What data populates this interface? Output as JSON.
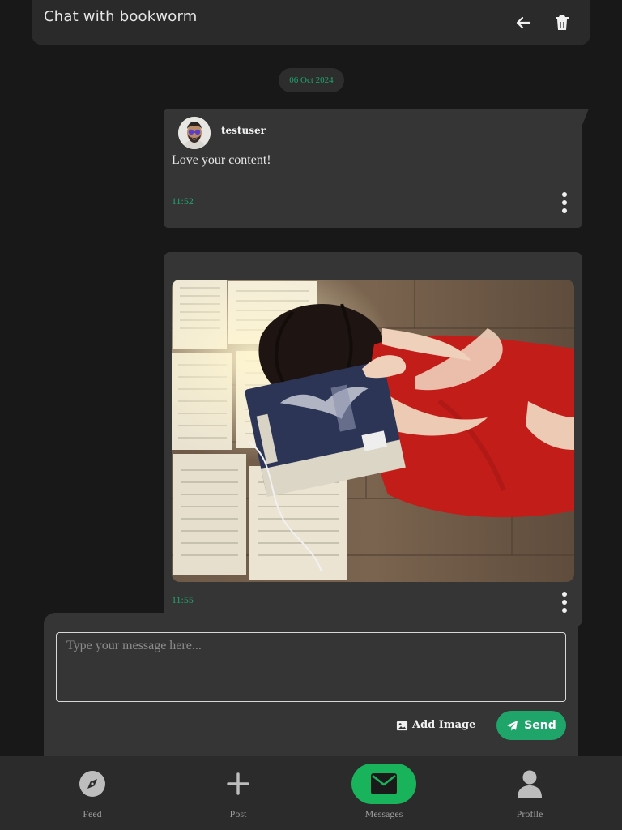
{
  "header": {
    "title": "Chat with bookworm",
    "back_icon": "arrow-left-icon",
    "delete_icon": "trash-icon"
  },
  "date_separator": "06 Oct 2024",
  "messages": [
    {
      "sender": "testuser",
      "text": "Love your content!",
      "time": "11:52",
      "options_icon": "more-vertical-icon"
    },
    {
      "image": "photo of woman lying among open books, holding a book over her face",
      "time": "11:55",
      "options_icon": "more-vertical-icon"
    }
  ],
  "composer": {
    "placeholder": "Type your message here...",
    "value": "",
    "add_image_label": "Add Image",
    "add_image_icon": "image-icon",
    "send_label": "Send",
    "send_icon": "paper-plane-icon"
  },
  "nav": {
    "items": [
      {
        "label": "Feed",
        "icon": "compass-icon",
        "active": false
      },
      {
        "label": "Post",
        "icon": "plus-icon",
        "active": false
      },
      {
        "label": "Messages",
        "icon": "envelope-icon",
        "active": true
      },
      {
        "label": "Profile",
        "icon": "user-icon",
        "active": false
      }
    ]
  },
  "colors": {
    "background": "#181818",
    "card": "#2a2a2a",
    "bubble": "#353535",
    "accent_green": "#1fa56a",
    "active_nav": "#19b35c",
    "nav_bar": "#2b2b2b"
  }
}
